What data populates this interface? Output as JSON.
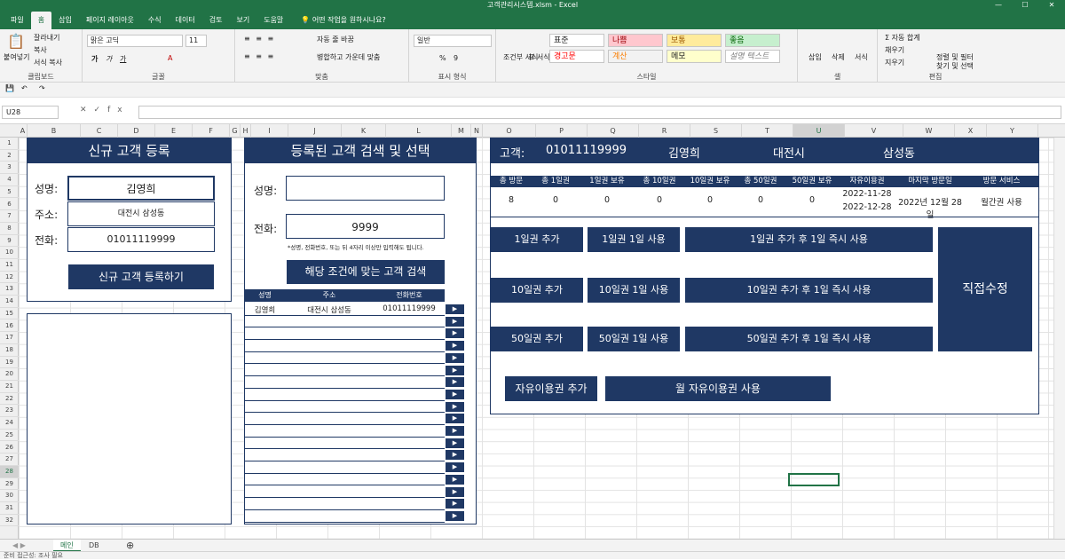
{
  "window": {
    "title": "고객관리시스템.xlsm - Excel",
    "min": "—",
    "max": "☐",
    "close": "✕"
  },
  "tabs": [
    "파일",
    "홈",
    "삽입",
    "페이지 레이아웃",
    "수식",
    "데이터",
    "검토",
    "보기",
    "도움말"
  ],
  "tell_me": "어떤 작업을 원하시나요?",
  "ribbon": {
    "clipboard": {
      "paste": "붙여넣기",
      "cut": "잘라내기",
      "copy": "복사",
      "format_painter": "서식 복사",
      "name": "클립보드"
    },
    "font": {
      "family": "맑은 고딕",
      "size": "11",
      "bold": "가",
      "italic": "가",
      "underline": "가",
      "name": "글꼴"
    },
    "align": {
      "wrap": "자동 줄 바꿈",
      "merge": "병합하고 가운데 맞춤",
      "name": "맞춤"
    },
    "number": {
      "format": "일반",
      "percent": "%",
      "comma": "9",
      "name": "표시 형식"
    },
    "styles": {
      "cond": "조건부 서식",
      "table": "표 서식",
      "cells": [
        "표준",
        "나쁨",
        "보통",
        "좋음",
        "경고문",
        "계산",
        "메모",
        "설명 텍스트"
      ],
      "name": "스타일"
    },
    "cells": {
      "insert": "삽입",
      "delete": "삭제",
      "format": "서식",
      "name": "셀"
    },
    "editing": {
      "autosum": "자동 합계",
      "fill": "채우기",
      "clear": "지우기",
      "sort": "정렬 및 필터",
      "find": "찾기 및 선택",
      "name": "편집"
    }
  },
  "namebox": "U28",
  "formula": "",
  "columns": [
    "A",
    "B",
    "C",
    "D",
    "E",
    "F",
    "G",
    "H",
    "I",
    "J",
    "K",
    "L",
    "M",
    "N",
    "O",
    "P",
    "Q",
    "R",
    "S",
    "T",
    "U",
    "V",
    "W",
    "X",
    "Y"
  ],
  "rows": [
    "1",
    "2",
    "3",
    "4",
    "5",
    "6",
    "7",
    "8",
    "9",
    "10",
    "11",
    "12",
    "13",
    "14",
    "15",
    "16",
    "17",
    "18",
    "19",
    "20",
    "21",
    "22",
    "23",
    "24",
    "25",
    "26",
    "27",
    "28",
    "29",
    "30",
    "31",
    "32"
  ],
  "register": {
    "title": "신규 고객 등록",
    "name_label": "성명:",
    "name_value": "김영희",
    "addr_label": "주소:",
    "addr_value": "대전시 삼성동",
    "phone_label": "전화:",
    "phone_value": "01011119999",
    "button": "신규 고객 등록하기"
  },
  "search": {
    "title": "등록된 고객 검색 및 선택",
    "name_label": "성명:",
    "name_value": "",
    "phone_label": "전화:",
    "phone_value": "9999",
    "hint": "*성명, 전화번호, 또는 뒤 4자리 이상만 입력해도 됩니다.",
    "button": "해당 조건에 맞는 고객 검색",
    "columns": [
      "성명",
      "주소",
      "전화번호"
    ],
    "results": [
      {
        "name": "김영희",
        "addr": "대전시 삼성동",
        "phone": "01011119999"
      }
    ],
    "select_glyph": "▶"
  },
  "detail": {
    "customer_label": "고객:",
    "phone": "01011119999",
    "name": "김영희",
    "city": "대전시",
    "district": "삼성동",
    "headers": [
      "총 방문",
      "총 1일권",
      "1일권 보유",
      "총 10일권",
      "10일권 보유",
      "총 50일권",
      "50일권 보유",
      "자유이용권",
      "마지막 방문일",
      "방문 서비스"
    ],
    "values": [
      "8",
      "0",
      "0",
      "0",
      "0",
      "0",
      "0",
      "2022-11-28",
      "2022년 12월 28일",
      "월간권 사용"
    ],
    "free_pass_end": "2022-12-28",
    "buttons": {
      "add1": "1일권 추가",
      "use1": "1일권 1일 사용",
      "addUse1": "1일권 추가 후 1일 즉시 사용",
      "add10": "10일권 추가",
      "use10": "10일권 1일 사용",
      "addUse10": "10일권 추가 후 1일 즉시 사용",
      "add50": "50일권 추가",
      "use50": "50일권 1일 사용",
      "addUse50": "50일권 추가 후 1일 즉시 사용",
      "edit": "직접수정",
      "addFree": "자유이용권 추가",
      "useMonthly": "월 자유이용권 사용"
    }
  },
  "sheets": [
    "메인",
    "DB"
  ],
  "status": "준비  접근성: 조사 필요",
  "colors": {
    "excel_green": "#217346",
    "navy": "#1f3864"
  }
}
